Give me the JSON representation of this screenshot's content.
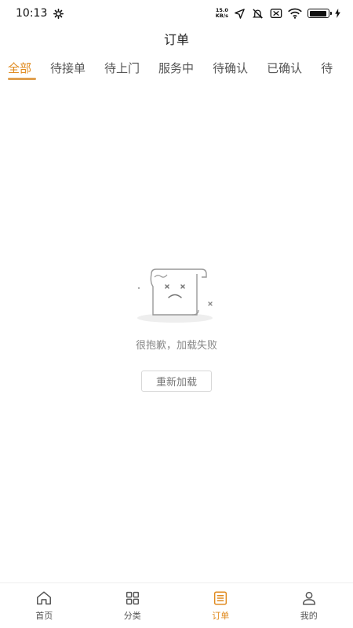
{
  "status_bar": {
    "time": "10:13",
    "speed_value": "15.0",
    "speed_unit": "KB/s",
    "battery_level": 0.95
  },
  "header": {
    "title": "订单"
  },
  "tabs": [
    {
      "label": "全部",
      "active": true
    },
    {
      "label": "待接单",
      "active": false
    },
    {
      "label": "待上门",
      "active": false
    },
    {
      "label": "服务中",
      "active": false
    },
    {
      "label": "待确认",
      "active": false
    },
    {
      "label": "已确认",
      "active": false
    },
    {
      "label": "待",
      "active": false
    }
  ],
  "empty_state": {
    "message": "很抱歉，加载失败",
    "reload_label": "重新加载"
  },
  "bottom_nav": [
    {
      "label": "首页",
      "icon": "home-icon",
      "active": false
    },
    {
      "label": "分类",
      "icon": "grid-icon",
      "active": false
    },
    {
      "label": "订单",
      "icon": "order-list-icon",
      "active": true
    },
    {
      "label": "我的",
      "icon": "user-icon",
      "active": false
    }
  ],
  "colors": {
    "accent": "#e08a1e",
    "text": "#555555"
  }
}
